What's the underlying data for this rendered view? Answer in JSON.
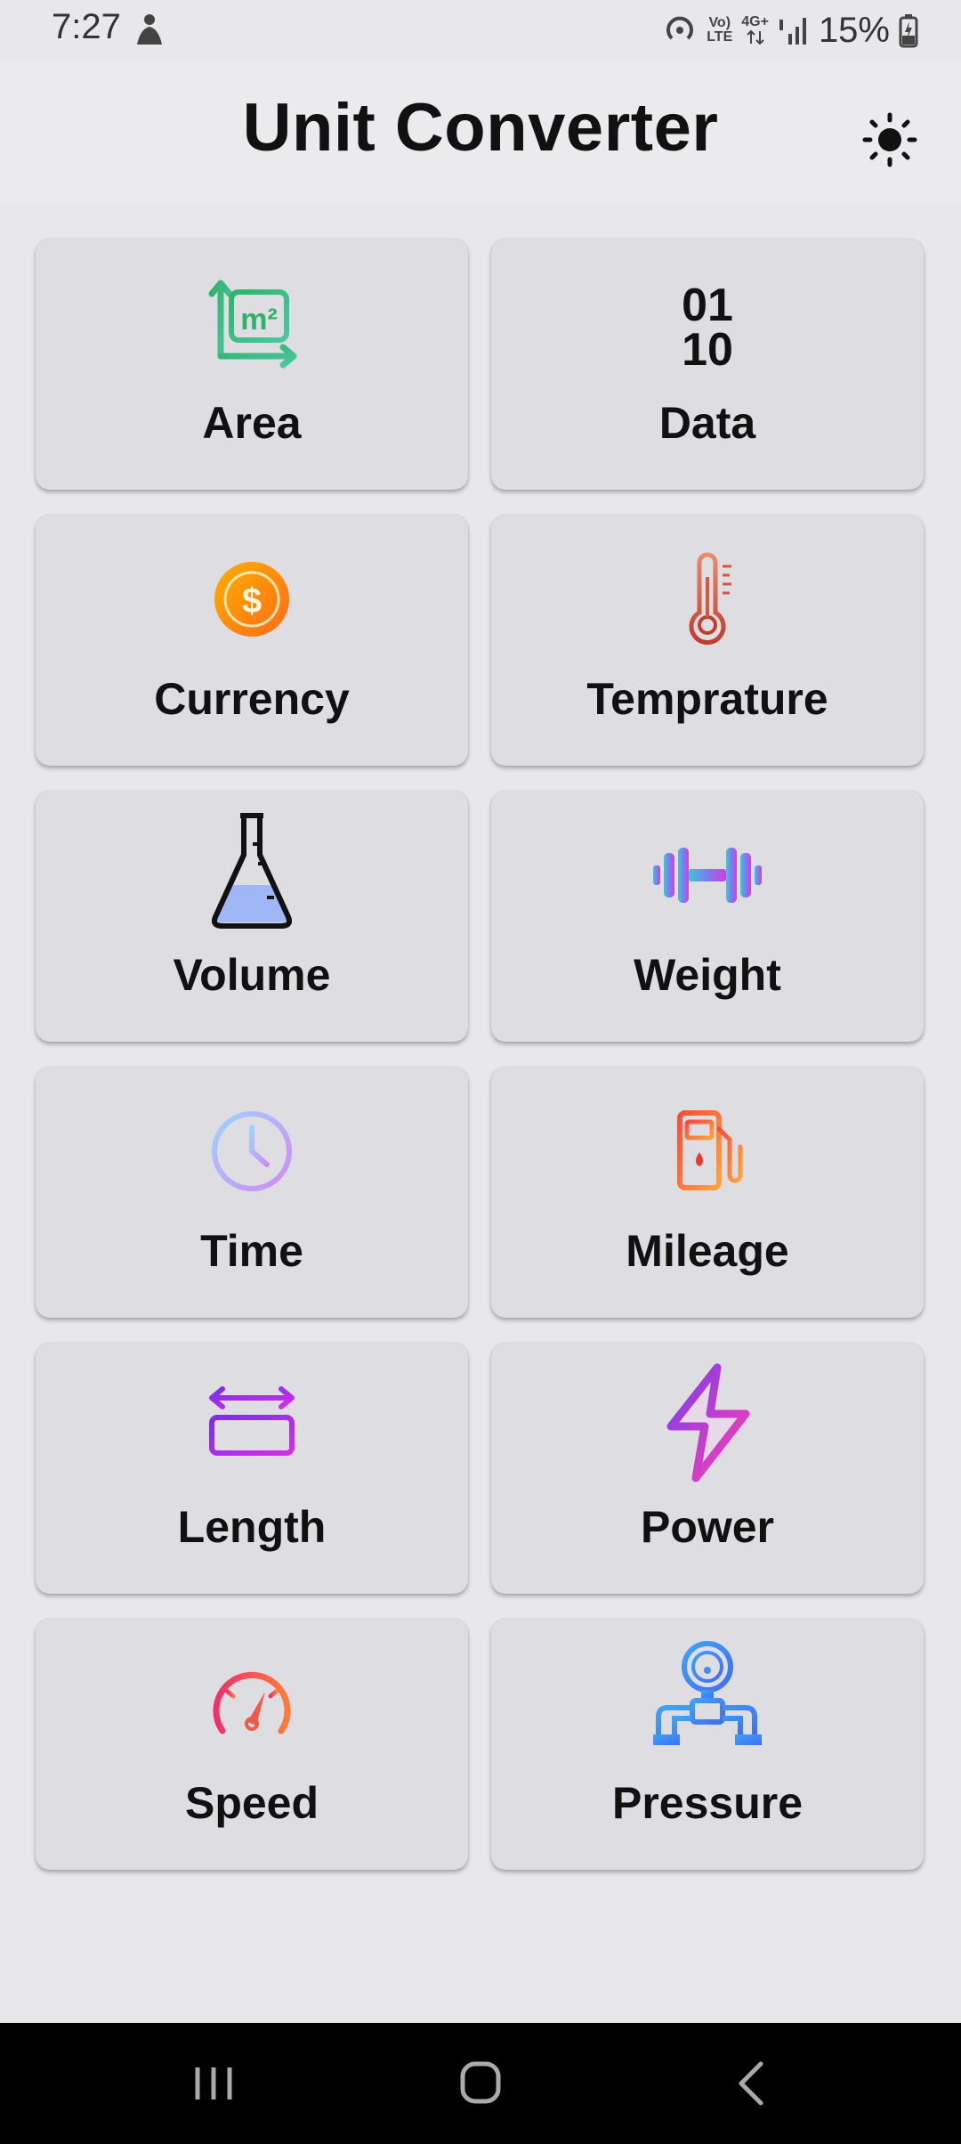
{
  "status": {
    "time": "7:27",
    "battery": "15%",
    "net_top": "4G+",
    "volte_top": "Vo)",
    "volte_bottom": "LTE"
  },
  "header": {
    "title": "Unit Converter"
  },
  "categories": [
    {
      "label": "Area",
      "icon": "area-icon"
    },
    {
      "label": "Data",
      "icon": "data-binary-icon"
    },
    {
      "label": "Currency",
      "icon": "currency-coin-icon"
    },
    {
      "label": "Temprature",
      "icon": "thermometer-icon"
    },
    {
      "label": "Volume",
      "icon": "flask-icon"
    },
    {
      "label": "Weight",
      "icon": "dumbbell-icon"
    },
    {
      "label": "Time",
      "icon": "clock-icon"
    },
    {
      "label": "Mileage",
      "icon": "fuel-pump-icon"
    },
    {
      "label": "Length",
      "icon": "ruler-icon"
    },
    {
      "label": "Power",
      "icon": "lightning-icon"
    },
    {
      "label": "Speed",
      "icon": "speedometer-icon"
    },
    {
      "label": "Pressure",
      "icon": "pressure-gauge-icon"
    }
  ],
  "data_icon_text": {
    "top": "01",
    "bottom": "10"
  },
  "area_icon_text": "m²",
  "currency_icon_text": "$"
}
